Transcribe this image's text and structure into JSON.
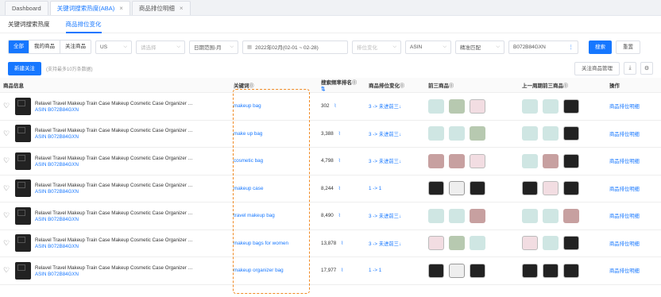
{
  "tabs": [
    {
      "label": "Dashboard",
      "active": false,
      "closable": false
    },
    {
      "label": "关键词搜索热度(ABA)",
      "active": true,
      "closable": true
    },
    {
      "label": "商品排位明细",
      "active": false,
      "closable": true
    }
  ],
  "subtabs": [
    {
      "label": "关键词搜索热度",
      "active": false
    },
    {
      "label": "商品排位变化",
      "active": true
    }
  ],
  "filters": {
    "segments": [
      "全部",
      "我的商品",
      "关注商品"
    ],
    "country": "US",
    "type_placeholder": "请选择",
    "date_range_type": "日期范围-月",
    "date_range": "2022年02月(02-01 ~ 02-28)",
    "rank_change_placeholder": "排位变化",
    "asin_type": "ASIN",
    "match_type": "精准匹配",
    "asin_value": "B072B84GXN",
    "search_label": "搜索",
    "reset_label": "重置"
  },
  "actions": {
    "new_follow": "新建关注",
    "hint": "(支持最多10万条数据)",
    "manage_follow": "关注商品管理"
  },
  "table": {
    "headers": [
      "商品信息",
      "关键词",
      "搜索频率排名",
      "商品排位变化",
      "前三商品",
      "上一周期前三商品",
      "操作"
    ],
    "product_title": "Relavel Travel Makeup Train Case Makeup Cosmetic Case Organizer Porta...",
    "asin_label": "ASIN B072B84GXN",
    "op_label": "商品排位明细",
    "rows": [
      {
        "keyword": "makeup bag",
        "rank": "302",
        "change": "3 -> 未进前三↓",
        "top3": [
          "t",
          "g",
          "p"
        ],
        "prev": [
          "t",
          "t",
          "k"
        ]
      },
      {
        "keyword": "make up bag",
        "rank": "3,388",
        "change": "3 -> 未进前三↓",
        "top3": [
          "t",
          "t",
          "g"
        ],
        "prev": [
          "t",
          "t",
          "k"
        ]
      },
      {
        "keyword": "cosmetic bag",
        "rank": "4,798",
        "change": "3 -> 未进前三↓",
        "top3": [
          "r",
          "r",
          "p"
        ],
        "prev": [
          "t",
          "r",
          "k"
        ]
      },
      {
        "keyword": "makeup case",
        "rank": "8,244",
        "change": "1 -> 1",
        "top3": [
          "k",
          "w",
          "k"
        ],
        "prev": [
          "k",
          "p",
          "k"
        ]
      },
      {
        "keyword": "travel makeup bag",
        "rank": "8,490",
        "change": "3 -> 未进前三↓",
        "top3": [
          "t",
          "t",
          "r"
        ],
        "prev": [
          "t",
          "t",
          "r"
        ]
      },
      {
        "keyword": "makeup bags for women",
        "rank": "13,878",
        "change": "3 -> 未进前三↓",
        "top3": [
          "p",
          "g",
          "t"
        ],
        "prev": [
          "p",
          "t",
          "k"
        ]
      },
      {
        "keyword": "makeup organizer bag",
        "rank": "17,977",
        "change": "1 -> 1",
        "top3": [
          "k",
          "w",
          "k"
        ],
        "prev": [
          "k",
          "k",
          "k"
        ]
      }
    ]
  }
}
